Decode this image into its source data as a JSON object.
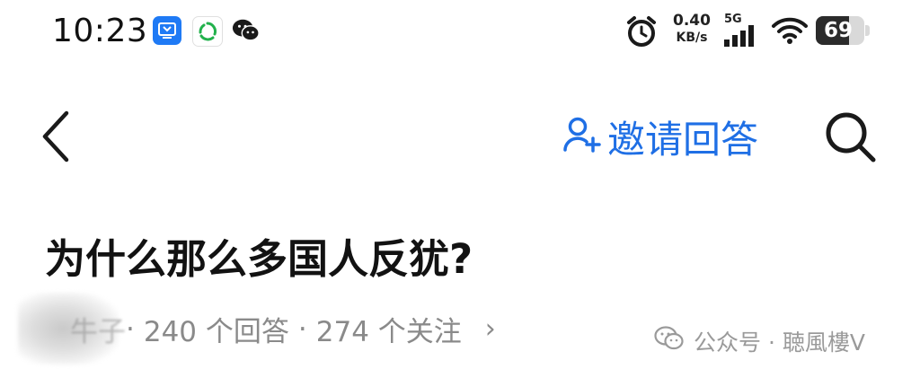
{
  "status_bar": {
    "time": "10:23",
    "net_speed_value": "0.40",
    "net_speed_unit": "KB/s",
    "network_type": "5G",
    "battery_text": "69",
    "battery_level_percent": 69,
    "icons": [
      "app-blue-icon",
      "app-green-icon",
      "wechat-icon",
      "alarm-icon",
      "signal-bars-icon",
      "wifi-icon",
      "battery-icon"
    ]
  },
  "nav": {
    "back_icon": "chevron-left-icon",
    "invite_icon": "person-add-icon",
    "invite_label": "邀请回答",
    "search_icon": "search-icon"
  },
  "question": {
    "title": "为什么那么多国人反犹?",
    "author_blurred": "牛子",
    "answers": "240 个回答",
    "follows": "274 个关注",
    "separator": "·",
    "chevron": "›"
  },
  "watermark": {
    "text": "公众号 · 聴風樓V",
    "icon": "wechat-icon"
  },
  "colors": {
    "accent": "#1f6fe5",
    "text_primary": "#121212",
    "text_secondary": "#8a8a8a",
    "watermark": "#9a9a9a"
  }
}
